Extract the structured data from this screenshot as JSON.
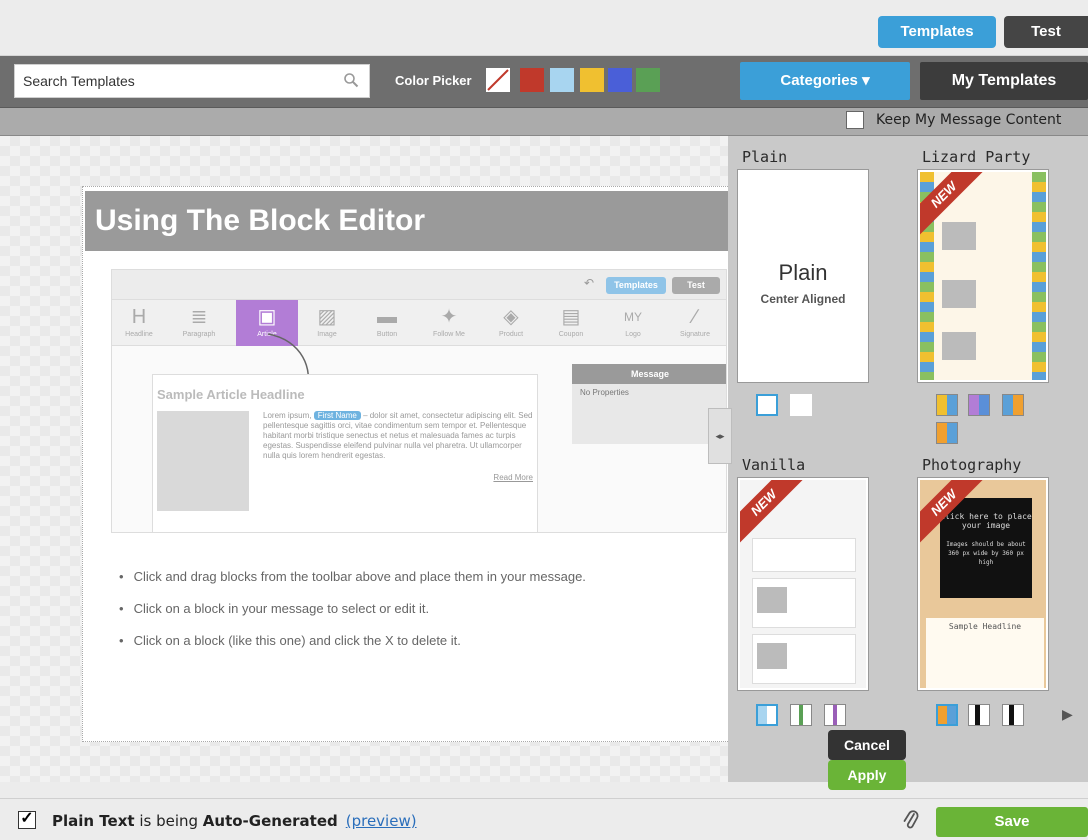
{
  "header": {
    "templates_tab": "Templates",
    "test_tab": "Test"
  },
  "toolbar": {
    "search_placeholder": "Search Templates",
    "color_picker_label": "Color Picker",
    "swatches": [
      "#c0392b",
      "#a8d5f0",
      "#f0c030",
      "#4a5fd8",
      "#5aa055"
    ],
    "categories_label": "Categories ▾",
    "my_templates_label": "My Templates"
  },
  "keep": {
    "label": "Keep My Message Content"
  },
  "editor": {
    "headline": "Using The Block Editor",
    "preview": {
      "templates_btn": "Templates",
      "test_btn": "Test",
      "tools": [
        "Headline",
        "Paragraph",
        "Article",
        "Image",
        "Button",
        "Follow Me",
        "Product",
        "Coupon",
        "Logo",
        "Signature"
      ],
      "article_headline": "Sample Article Headline",
      "article_body_pre": "Lorem ipsum,",
      "first_name": "First Name",
      "article_body_post": "– dolor sit amet, consectetur adipiscing elit. Sed pellentesque sagittis orci, vitae condimentum sem tempor et. Pellentesque habitant morbi tristique senectus et netus et malesuada fames ac turpis egestas. Suspendisse eleifend pulvinar nulla vel pharetra. Ut ullamcorper nulla quis lorem hendrerit egestas.",
      "read_more": "Read More",
      "message_title": "Message",
      "message_body": "No Properties"
    },
    "bullets": [
      "Click and drag blocks from the toolbar above and place them in your message.",
      "Click on a block in your message to select or edit it.",
      "Click on a block (like this one) and click the X to delete it."
    ]
  },
  "templates": {
    "plain": {
      "name": "Plain",
      "big": "Plain",
      "sub": "Center Aligned"
    },
    "lizard": {
      "name": "Lizard Party"
    },
    "vanilla": {
      "name": "Vanilla"
    },
    "photo": {
      "name": "Photography",
      "click": "Click here to place your image",
      "note": "Images should be about 360 px wide by 360 px high",
      "headline": "Sample Headline"
    },
    "new_badge": "NEW"
  },
  "actions": {
    "cancel": "Cancel",
    "apply": "Apply"
  },
  "footer": {
    "plain_text": "Plain Text",
    "is_being": " is being ",
    "auto": "Auto-Generated",
    "preview": "(preview)",
    "save": "Save"
  }
}
